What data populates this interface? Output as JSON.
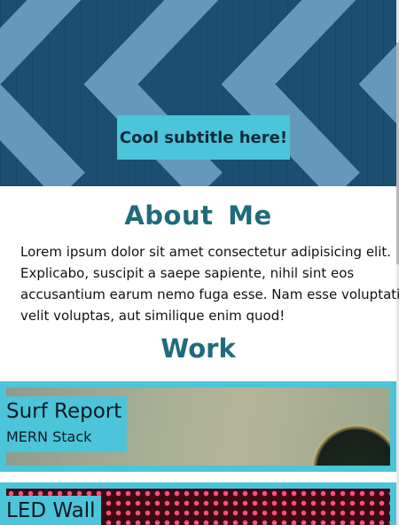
{
  "hero": {
    "subtitle": "Cool subtitle here!",
    "colors": {
      "background": "#1b4f72",
      "chevron": "#6a9dc1",
      "badge": "#4cc4d9"
    }
  },
  "about": {
    "heading": "About  Me",
    "lines": [
      "Lorem ipsum dolor sit amet consectetur adipisicing elit.",
      "Explicabo, suscipit a saepe sapiente, nihil sint eos",
      "accusantium earum nemo fuga esse. Nam esse voluptatibus",
      "velit voluptas, aut similique enim quod!"
    ]
  },
  "work": {
    "heading": "Work",
    "projects": [
      {
        "title": "Surf Report",
        "subtitle": "MERN Stack"
      },
      {
        "title": "LED Wall",
        "subtitle": ""
      }
    ]
  },
  "theme": {
    "accent": "#4cc4d9",
    "heading": "#1f6b7d"
  }
}
